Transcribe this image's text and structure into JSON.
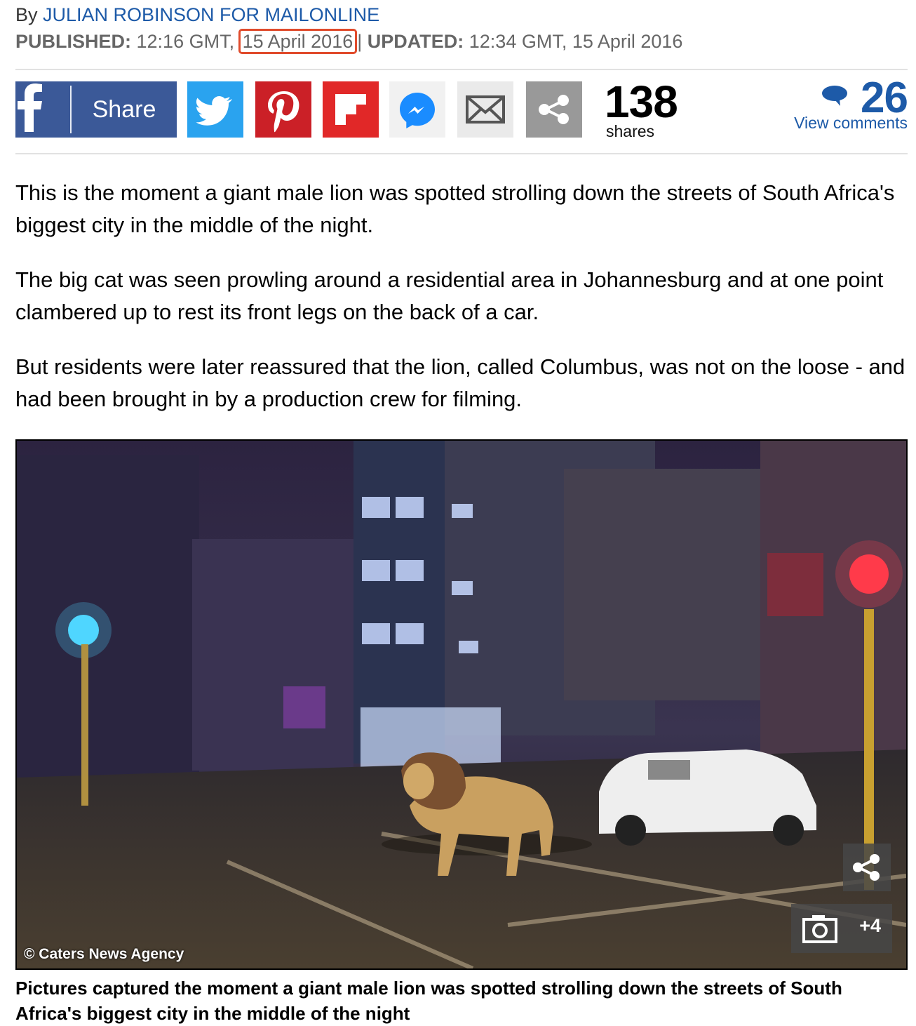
{
  "byline": {
    "prefix": "By ",
    "author": "JULIAN ROBINSON FOR MAILONLINE"
  },
  "dates": {
    "published_label": "PUBLISHED:",
    "published_time": " 12:16 GMT,",
    "published_date": "15 April 2016",
    "separator": "|",
    "updated_label": "UPDATED:",
    "updated_value": " 12:34 GMT, 15 April 2016"
  },
  "share_bar": {
    "facebook_label": "Share",
    "share_count": "138",
    "share_count_label": "shares",
    "comment_count": "26",
    "comments_link": "View comments"
  },
  "article": {
    "paragraphs": [
      "This is the moment a giant male lion was spotted strolling down the streets of South Africa's biggest city in the middle of the night.",
      "The big cat was seen prowling around a residential area in Johannesburg and at one point clambered up to rest its front legs on the back of a car.",
      "But residents were later reassured that the lion, called Columbus, was not on the loose - and had been brought in by a production crew for filming."
    ]
  },
  "photo": {
    "credit": "© Caters News Agency",
    "gallery_more": "+4",
    "caption": "Pictures captured the moment a giant male lion was spotted strolling down the streets of South Africa's biggest city in the middle of the night"
  },
  "colors": {
    "link": "#1d5aa8",
    "highlight": "#e04b2c",
    "facebook": "#3b5998",
    "twitter": "#2aa3ef",
    "pinterest": "#cb2027",
    "flipboard": "#e12828"
  }
}
